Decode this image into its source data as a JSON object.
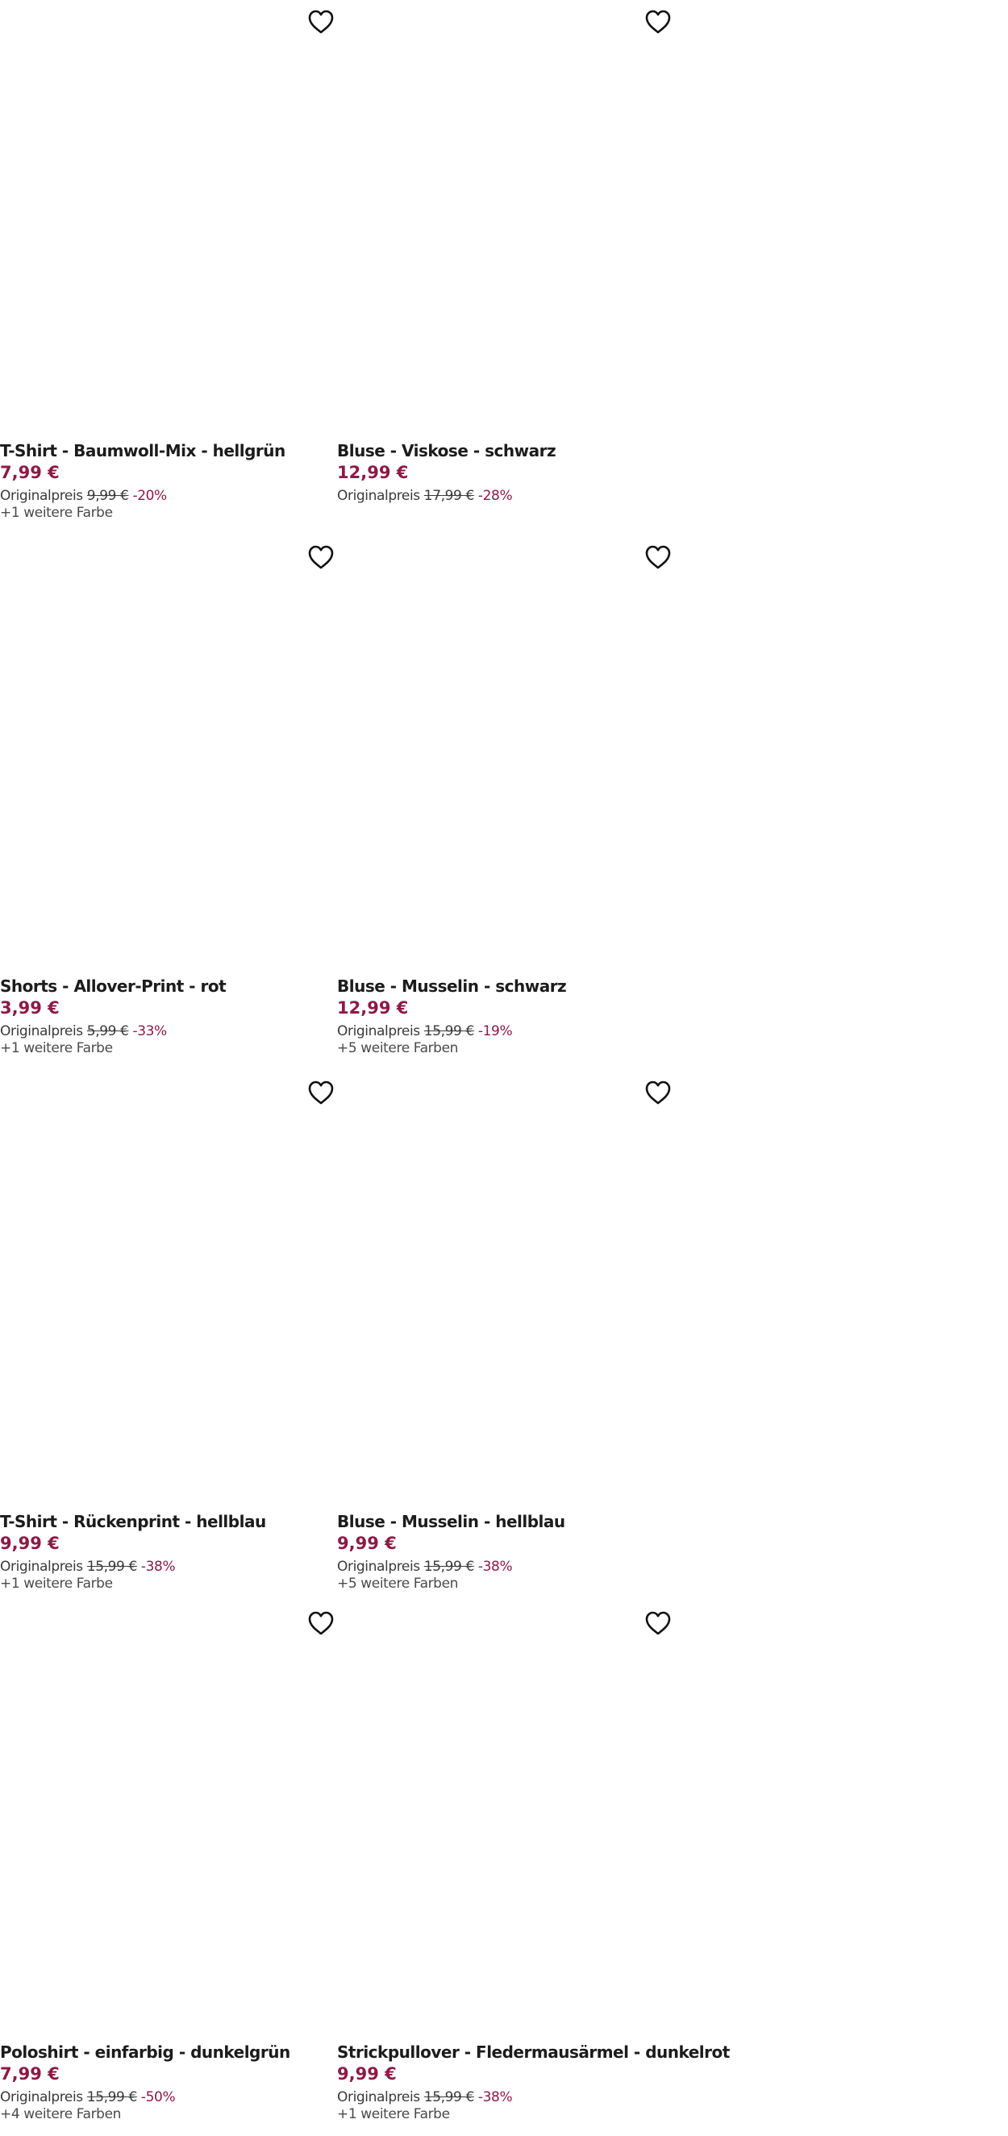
{
  "products": [
    {
      "title": "T-Shirt - Baumwoll-Mix - hellgrün",
      "price": "7,99 €",
      "original_label": "Originalpreis",
      "original_price": "9,99 €",
      "discount": "-20%",
      "more_colors": "+1 weitere Farbe"
    },
    {
      "title": "Bluse - Viskose - schwarz",
      "price": "12,99 €",
      "original_label": "Originalpreis",
      "original_price": "17,99 €",
      "discount": "-28%",
      "more_colors": ""
    },
    {
      "title": "Shorts - Allover-Print - rot",
      "price": "3,99 €",
      "original_label": "Originalpreis",
      "original_price": "5,99 €",
      "discount": "-33%",
      "more_colors": "+1 weitere Farbe"
    },
    {
      "title": "Bluse - Musselin - schwarz",
      "price": "12,99 €",
      "original_label": "Originalpreis",
      "original_price": "15,99 €",
      "discount": "-19%",
      "more_colors": "+5 weitere Farben"
    },
    {
      "title": "T-Shirt - Rückenprint - hellblau",
      "price": "9,99 €",
      "original_label": "Originalpreis",
      "original_price": "15,99 €",
      "discount": "-38%",
      "more_colors": "+1 weitere Farbe"
    },
    {
      "title": "Bluse - Musselin - hellblau",
      "price": "9,99 €",
      "original_label": "Originalpreis",
      "original_price": "15,99 €",
      "discount": "-38%",
      "more_colors": "+5 weitere Farben"
    },
    {
      "title": "Poloshirt - einfarbig - dunkelgrün",
      "price": "7,99 €",
      "original_label": "Originalpreis",
      "original_price": "15,99 €",
      "discount": "-50%",
      "more_colors": "+4 weitere Farben"
    },
    {
      "title": "Strickpullover - Fledermausärmel - dunkelrot",
      "price": "9,99 €",
      "original_label": "Originalpreis",
      "original_price": "15,99 €",
      "discount": "-38%",
      "more_colors": "+1 weitere Farbe"
    }
  ],
  "icons": {
    "wishlist": "heart-outline-icon"
  },
  "colors": {
    "accent_price": "#8d1a45",
    "text": "#1c1c1c",
    "background": "#ffffff"
  }
}
